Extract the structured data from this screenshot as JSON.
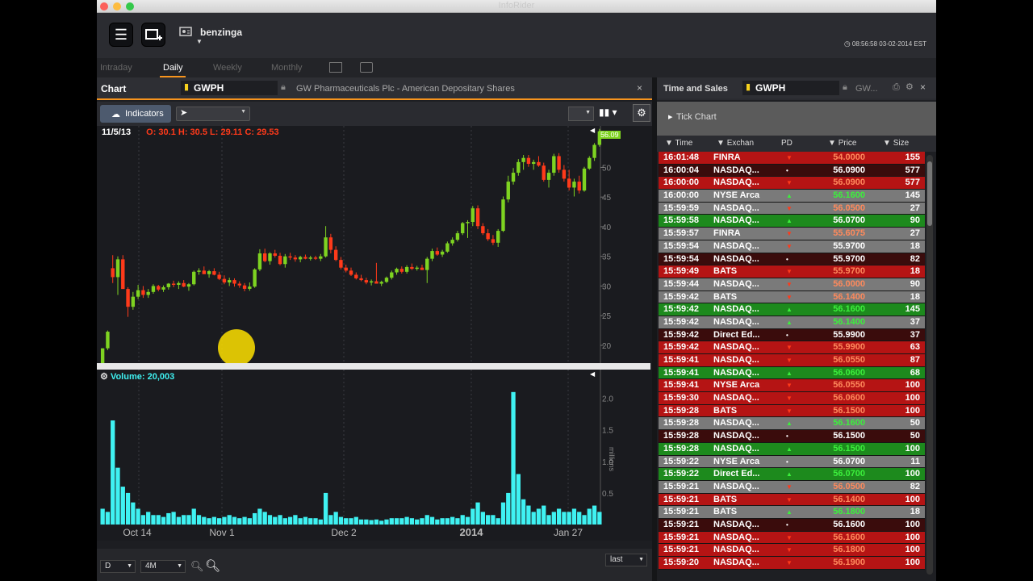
{
  "window": {
    "title": "InfoRider"
  },
  "toolbar": {
    "user": "benzinga",
    "clock": "08:56:58 03-02-2014 EST"
  },
  "periods": [
    {
      "label": "Intraday",
      "active": false
    },
    {
      "label": "Daily",
      "active": true
    },
    {
      "label": "Weekly",
      "active": false
    },
    {
      "label": "Monthly",
      "active": false
    }
  ],
  "chart_panel": {
    "title": "Chart",
    "symbol": "GWPH",
    "description": "GW Pharmaceuticals Plc - American Depositary Shares",
    "indicators_label": "Indicators",
    "date": "11/5/13",
    "ohlc": "O: 30.1  H: 30.5  L: 29.11  C: 29.53",
    "last_price_tag": "56.09",
    "volume_label": "Volume:",
    "volume_value": "20,003",
    "volume_unit": "millions",
    "period_select": "D",
    "range_select": "4M",
    "mode_select": "last"
  },
  "chart_data": {
    "type": "candlestick",
    "y_ticks": [
      20,
      25,
      30,
      35,
      40,
      45,
      50
    ],
    "ylim": [
      17,
      57
    ],
    "vol_ticks": [
      0.5,
      1.0,
      1.5,
      2.0
    ],
    "vol_ylim": [
      0,
      2.2
    ],
    "x_labels": [
      "Oct 14",
      "Nov 1",
      "Dec 2",
      "2014",
      "Jan 27"
    ],
    "candles": [
      [
        17,
        19.5,
        16.5,
        19.5,
        0.25
      ],
      [
        19.5,
        22.5,
        19.2,
        22.3,
        0.2
      ],
      [
        33,
        35.2,
        30.5,
        31.5,
        1.65
      ],
      [
        31.5,
        35,
        28.5,
        34.5,
        0.9
      ],
      [
        34.5,
        35.2,
        30,
        29.5,
        0.6
      ],
      [
        29.5,
        29.8,
        24.8,
        26.5,
        0.5
      ],
      [
        26.5,
        29,
        26,
        28.2,
        0.35
      ],
      [
        28.2,
        30.2,
        27.8,
        29.3,
        0.25
      ],
      [
        29.3,
        30,
        28,
        28.5,
        0.15
      ],
      [
        28.5,
        29.5,
        28,
        29,
        0.2
      ],
      [
        29,
        30.3,
        28.7,
        30,
        0.15
      ],
      [
        30,
        30.2,
        29.1,
        29.4,
        0.15
      ],
      [
        29.4,
        30.1,
        29,
        29.8,
        0.12
      ],
      [
        29.8,
        30.5,
        29.4,
        30.4,
        0.18
      ],
      [
        30.4,
        30.9,
        29.8,
        30.2,
        0.2
      ],
      [
        30.2,
        30.8,
        29.5,
        30.5,
        0.12
      ],
      [
        30.5,
        31,
        29.8,
        29.9,
        0.15
      ],
      [
        29.9,
        30.5,
        29.2,
        30.3,
        0.15
      ],
      [
        30.3,
        32.6,
        30.1,
        32.4,
        0.25
      ],
      [
        32.4,
        33,
        31.9,
        32.6,
        0.15
      ],
      [
        32.6,
        33.3,
        32.1,
        32,
        0.12
      ],
      [
        32,
        32.7,
        31.4,
        32.5,
        0.1
      ],
      [
        32.5,
        33,
        31.8,
        31.9,
        0.12
      ],
      [
        31.9,
        32.4,
        31,
        31.2,
        0.1
      ],
      [
        31.2,
        31.8,
        30.3,
        30.6,
        0.12
      ],
      [
        30.6,
        31.4,
        30,
        31,
        0.15
      ],
      [
        31,
        31.3,
        29.9,
        30.4,
        0.12
      ],
      [
        30.4,
        30.8,
        29.7,
        30.1,
        0.1
      ],
      [
        30.1,
        30.5,
        29.11,
        29.53,
        0.12
      ],
      [
        29.53,
        30.6,
        29.2,
        29.9,
        0.1
      ],
      [
        29.9,
        33,
        29.7,
        32.8,
        0.18
      ],
      [
        32.8,
        36.2,
        32.5,
        35.5,
        0.25
      ],
      [
        35.5,
        36.3,
        34,
        34.2,
        0.2
      ],
      [
        34.2,
        35.7,
        33.6,
        35.5,
        0.15
      ],
      [
        35.5,
        36.1,
        34.8,
        35.1,
        0.12
      ],
      [
        35.1,
        35.6,
        33.5,
        33.7,
        0.15
      ],
      [
        33.7,
        35.4,
        33.1,
        35,
        0.1
      ],
      [
        35,
        35.6,
        34.4,
        34.8,
        0.12
      ],
      [
        34.8,
        35.2,
        34.1,
        34.5,
        0.15
      ],
      [
        34.5,
        35.1,
        34,
        34.9,
        0.1
      ],
      [
        34.9,
        35.3,
        34.5,
        34.6,
        0.12
      ],
      [
        34.6,
        35.1,
        34.3,
        34.8,
        0.1
      ],
      [
        34.8,
        35.1,
        34.4,
        34.6,
        0.1
      ],
      [
        34.6,
        35.4,
        34.2,
        35,
        0.08
      ],
      [
        35,
        40.1,
        34.8,
        38.2,
        0.5
      ],
      [
        38.2,
        38.8,
        35.5,
        36.1,
        0.15
      ],
      [
        36.1,
        36.7,
        34.2,
        34.4,
        0.2
      ],
      [
        34.4,
        34.9,
        32.8,
        33.1,
        0.12
      ],
      [
        33.1,
        33.6,
        32.3,
        32.6,
        0.1
      ],
      [
        32.6,
        33.1,
        31.7,
        31.9,
        0.1
      ],
      [
        31.9,
        32.3,
        31.1,
        31.3,
        0.12
      ],
      [
        31.3,
        31.9,
        30.8,
        31,
        0.08
      ],
      [
        31,
        31.4,
        30.3,
        30.6,
        0.08
      ],
      [
        30.6,
        31.1,
        30.1,
        30.8,
        0.07
      ],
      [
        30.8,
        33.9,
        30.5,
        30.4,
        0.08
      ],
      [
        30.4,
        30.9,
        30,
        30.7,
        0.06
      ],
      [
        30.7,
        31.6,
        30.5,
        31.4,
        0.08
      ],
      [
        31.4,
        32.6,
        31.1,
        32.3,
        0.1
      ],
      [
        32.3,
        33.1,
        31.9,
        32.9,
        0.1
      ],
      [
        32.9,
        33.3,
        32.1,
        32.4,
        0.1
      ],
      [
        32.4,
        33.5,
        32.1,
        33.2,
        0.12
      ],
      [
        33.2,
        33.8,
        32.7,
        32.9,
        0.1
      ],
      [
        32.9,
        33.4,
        32.6,
        33.1,
        0.08
      ],
      [
        33.1,
        33.6,
        32.7,
        32.7,
        0.1
      ],
      [
        32.7,
        34.9,
        30.5,
        34.6,
        0.15
      ],
      [
        34.6,
        36.3,
        34.2,
        35.9,
        0.12
      ],
      [
        35.9,
        36.5,
        35.1,
        35.3,
        0.08
      ],
      [
        35.3,
        36.1,
        34.9,
        35.8,
        0.1
      ],
      [
        35.8,
        37.5,
        35.6,
        37.2,
        0.1
      ],
      [
        37.2,
        38.2,
        36.8,
        37.8,
        0.12
      ],
      [
        37.8,
        39.3,
        37.5,
        38.9,
        0.1
      ],
      [
        38.9,
        40.8,
        38.6,
        40.6,
        0.15
      ],
      [
        40.6,
        41.1,
        38.1,
        40.8,
        0.12
      ],
      [
        40.8,
        43.5,
        40.1,
        43.1,
        0.25
      ],
      [
        43.1,
        43.6,
        39.6,
        40.1,
        0.35
      ],
      [
        40.1,
        40.6,
        38.6,
        38.9,
        0.2
      ],
      [
        38.9,
        39.6,
        37.6,
        37.9,
        0.15
      ],
      [
        37.9,
        38.6,
        36.9,
        37.3,
        0.15
      ],
      [
        37.3,
        39.6,
        36.6,
        39.3,
        0.1
      ],
      [
        39.3,
        45.1,
        39.1,
        44.6,
        0.35
      ],
      [
        44.6,
        48.6,
        44.1,
        47.6,
        0.5
      ],
      [
        47.6,
        49.9,
        47.1,
        49.1,
        2.1
      ],
      [
        49.1,
        51.4,
        48.6,
        50.9,
        0.8
      ],
      [
        50.9,
        52.1,
        49.6,
        51.6,
        0.4
      ],
      [
        51.6,
        52.1,
        50.1,
        50.6,
        0.3
      ],
      [
        50.6,
        51.3,
        49.6,
        50.9,
        0.2
      ],
      [
        50.9,
        51.9,
        50.1,
        50.3,
        0.25
      ],
      [
        50.3,
        50.8,
        47.6,
        47.9,
        0.3
      ],
      [
        47.9,
        49.6,
        46.6,
        49.1,
        0.15
      ],
      [
        49.1,
        52.3,
        48.6,
        51.9,
        0.2
      ],
      [
        51.9,
        52.4,
        49.1,
        49.6,
        0.25
      ],
      [
        49.6,
        50.4,
        47.6,
        48.1,
        0.2
      ],
      [
        48.1,
        49.6,
        46.1,
        46.6,
        0.2
      ],
      [
        46.6,
        48.1,
        45.1,
        47.6,
        0.25
      ],
      [
        47.6,
        48.6,
        45.6,
        46.1,
        0.2
      ],
      [
        46.1,
        50.1,
        45.9,
        49.8,
        0.15
      ],
      [
        49.8,
        51.9,
        49.6,
        51.6,
        0.25
      ],
      [
        51.6,
        54.1,
        51.1,
        53.8,
        0.3
      ],
      [
        53.8,
        56.5,
        53.5,
        56.09,
        0.2
      ]
    ]
  },
  "time_sales": {
    "title": "Time and Sales",
    "symbol": "GWPH",
    "desc_short": "GW...",
    "tick_chart_label": "Tick Chart",
    "columns": [
      "Time",
      "Exchan",
      "PD",
      "Price",
      "Size"
    ],
    "rows": [
      {
        "time": "16:01:48",
        "exch": "FINRA",
        "pd": "▼",
        "price": "54.0000",
        "size": "155",
        "bg": "#b51414",
        "pc": "#ff8a5c"
      },
      {
        "time": "16:00:04",
        "exch": "NASDAQ...",
        "pd": "•",
        "price": "56.0900",
        "size": "577",
        "bg": "#3a0c0c",
        "pc": "#ffffff"
      },
      {
        "time": "16:00:00",
        "exch": "NASDAQ...",
        "pd": "▼",
        "price": "56.0900",
        "size": "577",
        "bg": "#b51414",
        "pc": "#ff8a5c"
      },
      {
        "time": "16:00:00",
        "exch": "NYSE Arca",
        "pd": "▲",
        "price": "56.1600",
        "size": "145",
        "bg": "#7a7a7a",
        "pc": "#3cf03c"
      },
      {
        "time": "15:59:59",
        "exch": "NASDAQ...",
        "pd": "▼",
        "price": "56.0500",
        "size": "27",
        "bg": "#7a7a7a",
        "pc": "#ff8a5c"
      },
      {
        "time": "15:59:58",
        "exch": "NASDAQ...",
        "pd": "▲",
        "price": "56.0700",
        "size": "90",
        "bg": "#1d8a1d",
        "pc": "#ffffff"
      },
      {
        "time": "15:59:57",
        "exch": "FINRA",
        "pd": "▼",
        "price": "55.6075",
        "size": "27",
        "bg": "#7a7a7a",
        "pc": "#ff8a5c"
      },
      {
        "time": "15:59:54",
        "exch": "NASDAQ...",
        "pd": "▼",
        "price": "55.9700",
        "size": "18",
        "bg": "#7a7a7a",
        "pc": "#ffffff"
      },
      {
        "time": "15:59:54",
        "exch": "NASDAQ...",
        "pd": "•",
        "price": "55.9700",
        "size": "82",
        "bg": "#3a0c0c",
        "pc": "#ffffff"
      },
      {
        "time": "15:59:49",
        "exch": "BATS",
        "pd": "▼",
        "price": "55.9700",
        "size": "18",
        "bg": "#b51414",
        "pc": "#ff8a5c"
      },
      {
        "time": "15:59:44",
        "exch": "NASDAQ...",
        "pd": "▼",
        "price": "56.0000",
        "size": "90",
        "bg": "#7a7a7a",
        "pc": "#ff8a5c"
      },
      {
        "time": "15:59:42",
        "exch": "BATS",
        "pd": "▼",
        "price": "56.1400",
        "size": "18",
        "bg": "#7a7a7a",
        "pc": "#ff8a5c"
      },
      {
        "time": "15:59:42",
        "exch": "NASDAQ...",
        "pd": "▲",
        "price": "56.1600",
        "size": "145",
        "bg": "#1d8a1d",
        "pc": "#3cf03c"
      },
      {
        "time": "15:59:42",
        "exch": "NASDAQ...",
        "pd": "▲",
        "price": "56.1400",
        "size": "37",
        "bg": "#7a7a7a",
        "pc": "#3cf03c"
      },
      {
        "time": "15:59:42",
        "exch": "Direct Ed...",
        "pd": "•",
        "price": "55.9900",
        "size": "37",
        "bg": "#3a0c0c",
        "pc": "#ffffff"
      },
      {
        "time": "15:59:42",
        "exch": "NASDAQ...",
        "pd": "▼",
        "price": "55.9900",
        "size": "63",
        "bg": "#b51414",
        "pc": "#ff8a5c"
      },
      {
        "time": "15:59:41",
        "exch": "NASDAQ...",
        "pd": "▼",
        "price": "56.0550",
        "size": "87",
        "bg": "#b51414",
        "pc": "#ff8a5c"
      },
      {
        "time": "15:59:41",
        "exch": "NASDAQ...",
        "pd": "▲",
        "price": "56.0600",
        "size": "68",
        "bg": "#1d8a1d",
        "pc": "#3cf03c"
      },
      {
        "time": "15:59:41",
        "exch": "NYSE Arca",
        "pd": "▼",
        "price": "56.0550",
        "size": "100",
        "bg": "#b51414",
        "pc": "#ff8a5c"
      },
      {
        "time": "15:59:30",
        "exch": "NASDAQ...",
        "pd": "▼",
        "price": "56.0600",
        "size": "100",
        "bg": "#b51414",
        "pc": "#ff8a5c"
      },
      {
        "time": "15:59:28",
        "exch": "BATS",
        "pd": "▼",
        "price": "56.1500",
        "size": "100",
        "bg": "#b51414",
        "pc": "#ff8a5c"
      },
      {
        "time": "15:59:28",
        "exch": "NASDAQ...",
        "pd": "▲",
        "price": "56.1600",
        "size": "50",
        "bg": "#7a7a7a",
        "pc": "#3cf03c"
      },
      {
        "time": "15:59:28",
        "exch": "NASDAQ...",
        "pd": "•",
        "price": "56.1500",
        "size": "50",
        "bg": "#3a0c0c",
        "pc": "#ffffff"
      },
      {
        "time": "15:59:28",
        "exch": "NASDAQ...",
        "pd": "▲",
        "price": "56.1500",
        "size": "100",
        "bg": "#1d8a1d",
        "pc": "#3cf03c"
      },
      {
        "time": "15:59:22",
        "exch": "NYSE Arca",
        "pd": "•",
        "price": "56.0700",
        "size": "11",
        "bg": "#7a7a7a",
        "pc": "#ffffff"
      },
      {
        "time": "15:59:22",
        "exch": "Direct Ed...",
        "pd": "▲",
        "price": "56.0700",
        "size": "100",
        "bg": "#1d8a1d",
        "pc": "#3cf03c"
      },
      {
        "time": "15:59:21",
        "exch": "NASDAQ...",
        "pd": "▼",
        "price": "56.0500",
        "size": "82",
        "bg": "#7a7a7a",
        "pc": "#ff8a5c"
      },
      {
        "time": "15:59:21",
        "exch": "BATS",
        "pd": "▼",
        "price": "56.1400",
        "size": "100",
        "bg": "#b51414",
        "pc": "#ff8a5c"
      },
      {
        "time": "15:59:21",
        "exch": "BATS",
        "pd": "▲",
        "price": "56.1800",
        "size": "18",
        "bg": "#7a7a7a",
        "pc": "#3cf03c"
      },
      {
        "time": "15:59:21",
        "exch": "NASDAQ...",
        "pd": "•",
        "price": "56.1600",
        "size": "100",
        "bg": "#3a0c0c",
        "pc": "#ffffff"
      },
      {
        "time": "15:59:21",
        "exch": "NASDAQ...",
        "pd": "▼",
        "price": "56.1600",
        "size": "100",
        "bg": "#b51414",
        "pc": "#ff8a5c"
      },
      {
        "time": "15:59:21",
        "exch": "NASDAQ...",
        "pd": "▼",
        "price": "56.1800",
        "size": "100",
        "bg": "#b51414",
        "pc": "#ff8a5c"
      },
      {
        "time": "15:59:20",
        "exch": "NASDAQ...",
        "pd": "▼",
        "price": "56.1900",
        "size": "100",
        "bg": "#b51414",
        "pc": "#ff8a5c"
      }
    ]
  },
  "colors": {
    "accent": "#f7941d",
    "up": "#7ed321",
    "down": "#ff3a1a",
    "volume": "#3ff2f2"
  }
}
